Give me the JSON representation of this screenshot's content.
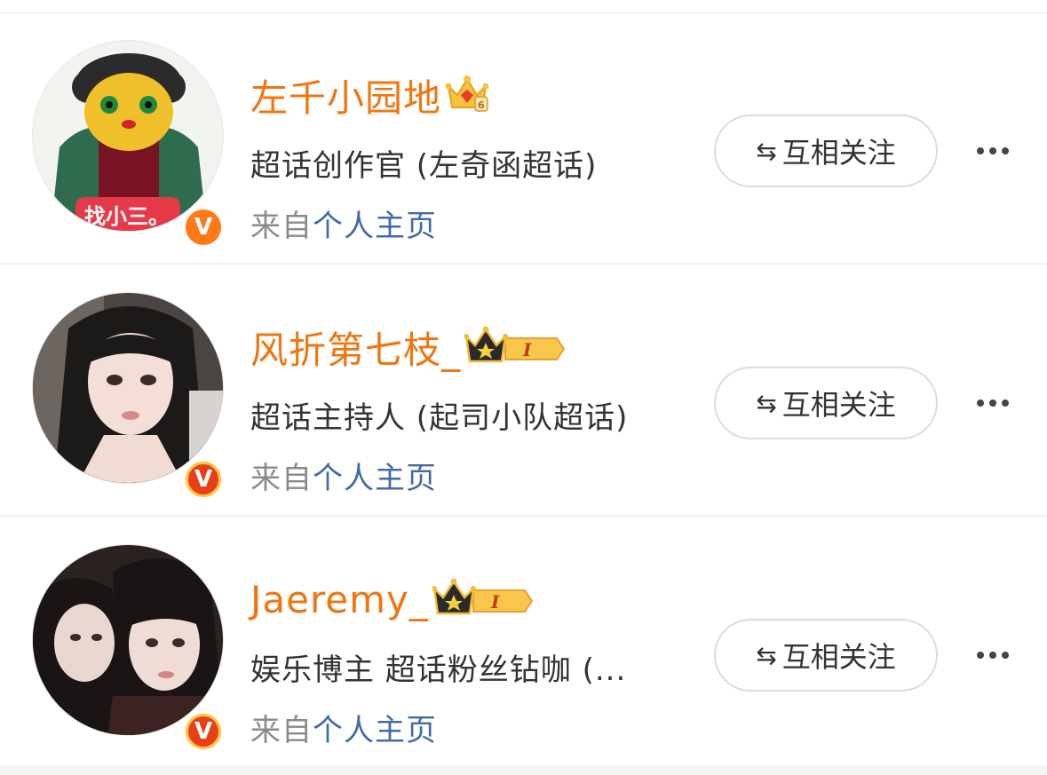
{
  "users": [
    {
      "name": "左千小园地",
      "bio": "超话创作官 (左奇函超话)",
      "source_prefix": "来自",
      "source_link": "个人主页",
      "follow_label": "互相关注",
      "avatar_sticker": "找小三。",
      "verified_icon": "orange-v-icon",
      "crown_icon": "svip-crown-icon"
    },
    {
      "name": "风折第七枝_",
      "bio": "超话主持人 (起司小队超话)",
      "source_prefix": "来自",
      "source_link": "个人主页",
      "follow_label": "互相关注",
      "verified_icon": "gold-v-icon",
      "crown_icon": "level-crown-icon",
      "level": "I"
    },
    {
      "name": "Jaeremy_",
      "bio": "娱乐博主 超话粉丝钻咖 (...",
      "source_prefix": "来自",
      "source_link": "个人主页",
      "follow_label": "互相关注",
      "verified_icon": "gold-v-icon",
      "crown_icon": "level-crown-icon",
      "level": "I"
    }
  ],
  "colors": {
    "name": "#f0750f",
    "link": "#436aa5",
    "verified_orange": "#ff7a16",
    "verified_gold": "#e64018"
  },
  "icons": {
    "swap": "⇆",
    "v": "V"
  }
}
